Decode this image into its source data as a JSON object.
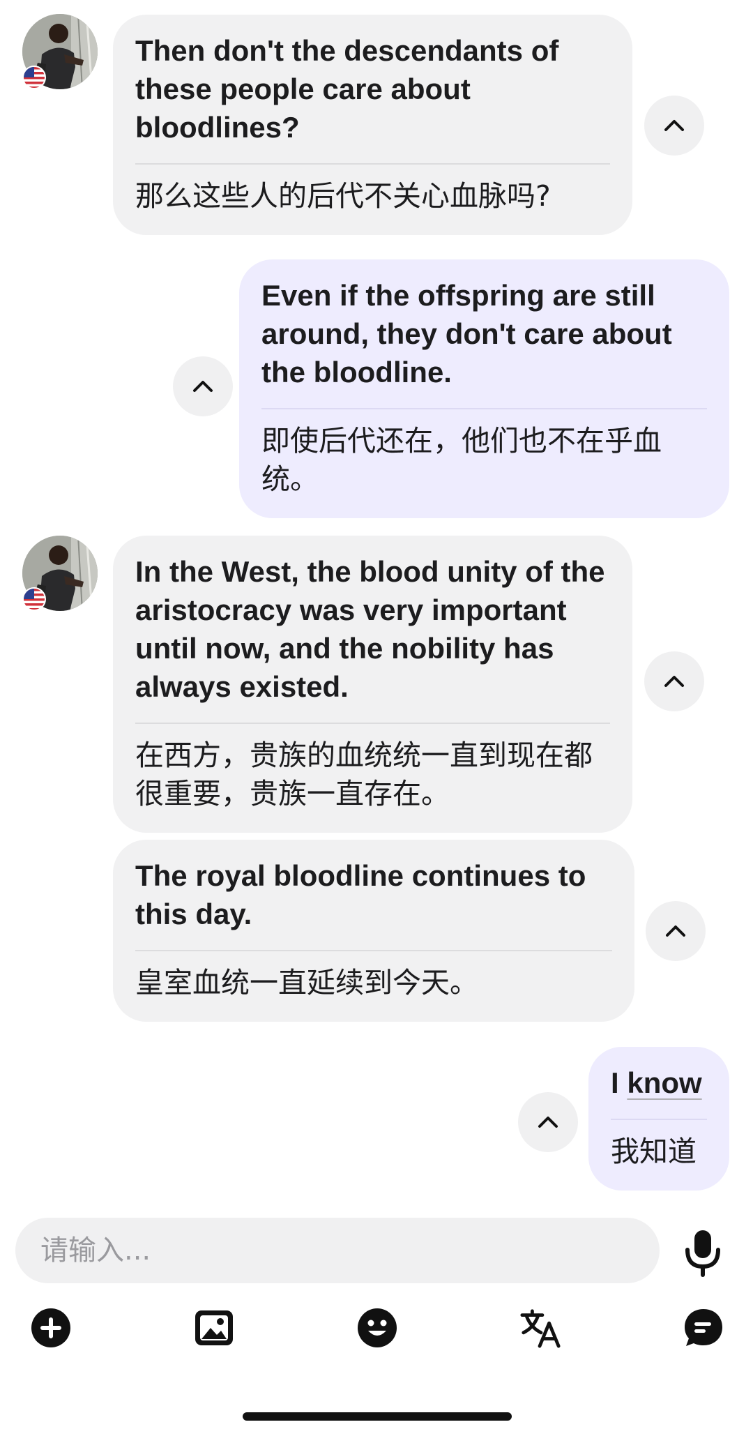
{
  "messages": [
    {
      "side": "incoming",
      "original": "Then don't the descendants of these people care about bloodlines?",
      "translation": "那么这些人的后代不关心血脉吗?"
    },
    {
      "side": "outgoing",
      "original": "Even if the offspring are still around, they don't care about the bloodline.",
      "translation": "即使后代还在，他们也不在乎血统。"
    },
    {
      "side": "incoming",
      "original": "In the West, the blood unity of the aristocracy was very important until now, and the nobility has always existed.",
      "translation": "在西方，贵族的血统统一直到现在都很重要，贵族一直存在。"
    },
    {
      "side": "incoming",
      "original": "The royal bloodline continues to this day.",
      "translation": "皇室血统一直延续到今天。"
    },
    {
      "side": "outgoing",
      "original_prefix": "I ",
      "original_underlined": "know",
      "translation": "我知道"
    }
  ],
  "composer": {
    "placeholder": "请输入..."
  },
  "icons": {
    "collapse": "chevron-up-icon",
    "mic": "microphone-icon",
    "toolbar": [
      "add-circle-icon",
      "image-icon",
      "emoji-icon",
      "translate-icon",
      "chat-bubble-icon"
    ]
  },
  "colors": {
    "incoming_bubble": "#f1f1f2",
    "outgoing_bubble": "#eeecfe",
    "chevron_bg": "#f0f0f1",
    "input_bg": "#f0f0f1"
  }
}
